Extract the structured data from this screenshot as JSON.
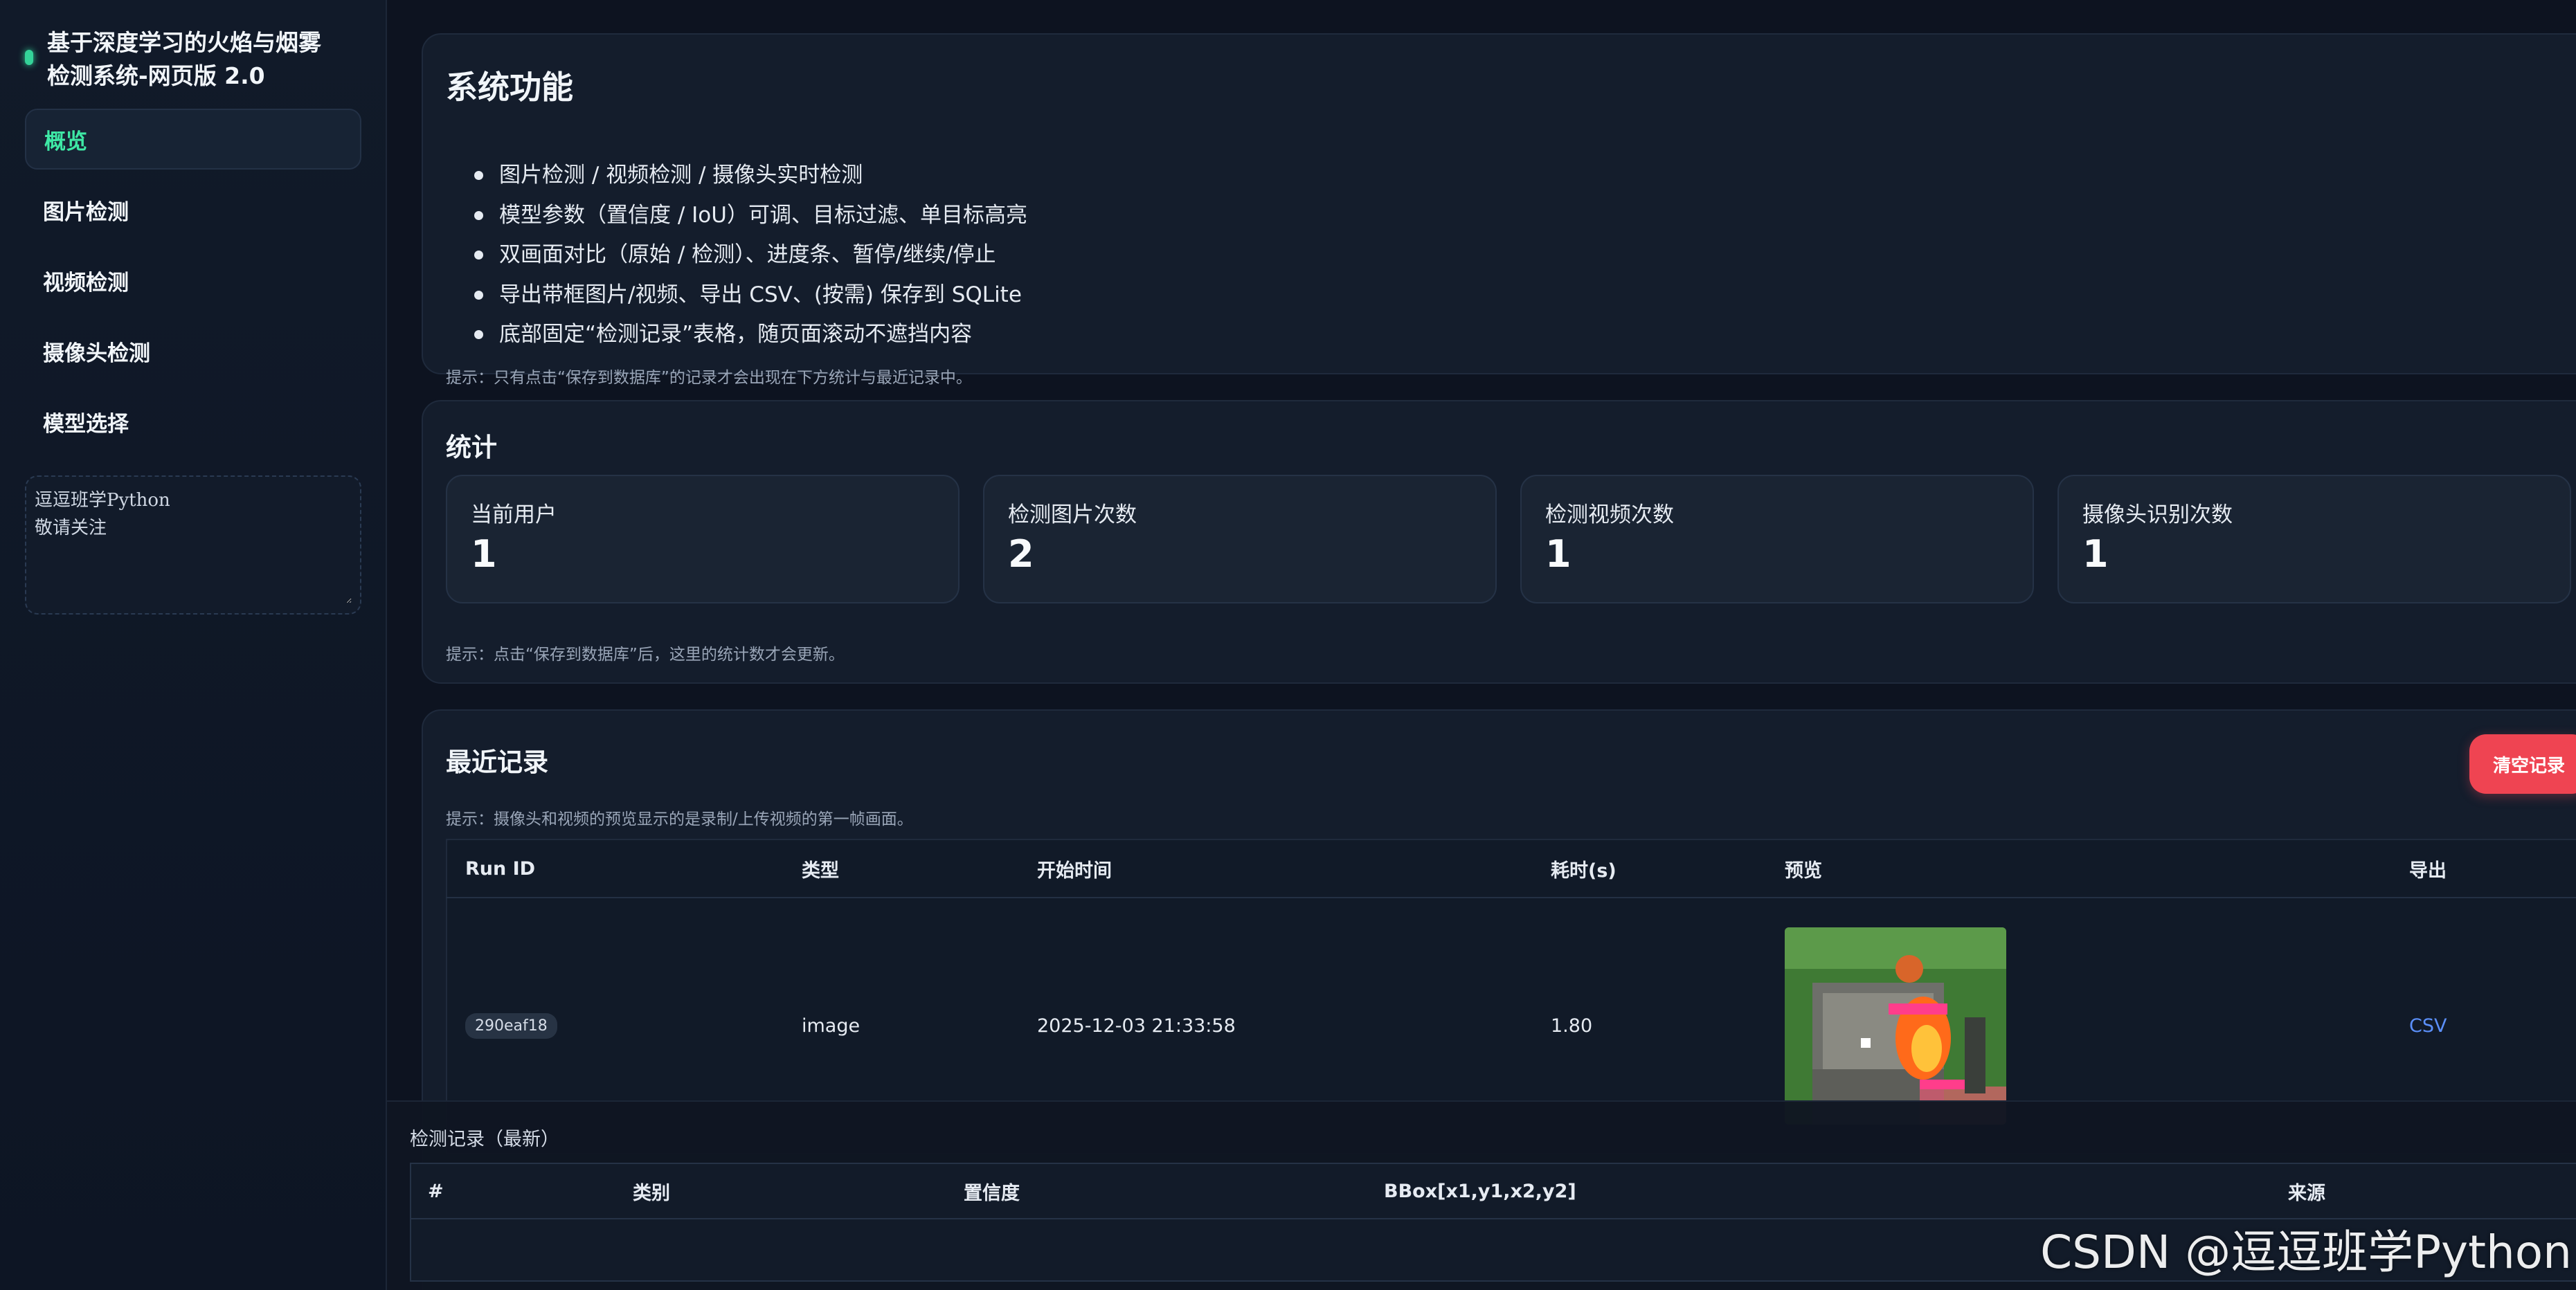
{
  "sidebar": {
    "brand_title": "基于深度学习的火焰与烟雾\n检测系统-网页版 2.0",
    "items": [
      {
        "label": "概览"
      },
      {
        "label": "图片检测"
      },
      {
        "label": "视频检测"
      },
      {
        "label": "摄像头检测"
      },
      {
        "label": "模型选择"
      }
    ],
    "note_text": "逗逗班学Python\n敬请关注"
  },
  "features": {
    "title": "系统功能",
    "items": [
      "图片检测 / 视频检测 / 摄像头实时检测",
      "模型参数（置信度 / IoU）可调、目标过滤、单目标高亮",
      "双画面对比（原始 / 检测）、进度条、暂停/继续/停止",
      "导出带框图片/视频、导出 CSV、(按需) 保存到 SQLite",
      "底部固定“检测记录”表格，随页面滚动不遮挡内容"
    ],
    "hint": "提示：只有点击“保存到数据库”的记录才会出现在下方统计与最近记录中。"
  },
  "stats": {
    "title": "统计",
    "cards": [
      {
        "label": "当前用户",
        "value": "1"
      },
      {
        "label": "检测图片次数",
        "value": "2"
      },
      {
        "label": "检测视频次数",
        "value": "1"
      },
      {
        "label": "摄像头识别次数",
        "value": "1"
      }
    ],
    "hint": "提示：点击“保存到数据库”后，这里的统计数才会更新。"
  },
  "recent": {
    "title": "最近记录",
    "clear_label": "清空记录",
    "hint": "提示：摄像头和视频的预览显示的是录制/上传视频的第一帧画面。",
    "columns": [
      "Run ID",
      "类型",
      "开始时间",
      "耗时(s)",
      "预览",
      "导出"
    ],
    "rows": [
      {
        "run_id": "290eaf18",
        "type": "image",
        "start_time": "2025-12-03 21:33:58",
        "duration": "1.80",
        "export": "CSV"
      }
    ]
  },
  "detections": {
    "title": "检测记录（最新）",
    "columns": [
      "#",
      "类别",
      "置信度",
      "BBox[x1,y1,x2,y2]",
      "来源"
    ]
  },
  "watermark": "CSDN @逗逗班学Python",
  "colors": {
    "accent": "#3ee8a5",
    "danger": "#ef4452",
    "link": "#5b8ff9",
    "background": "#0d1320",
    "card": "#141d2c"
  }
}
